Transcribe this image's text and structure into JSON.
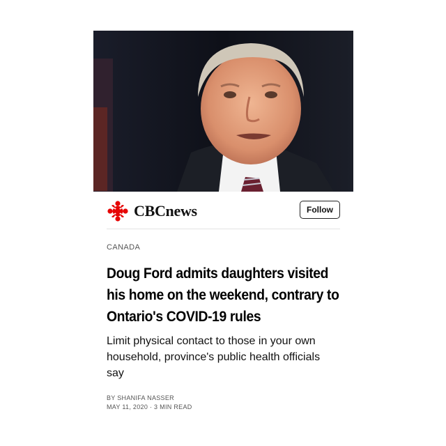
{
  "article": {
    "hero_image": "photo-of-man-speaking-at-podium",
    "publisher": {
      "name": "CBCnews",
      "logo_icon": "cbc-gem-icon",
      "follow_label": "Follow"
    },
    "section": "CANADA",
    "headline": "Doug Ford admits daughters visited his home on the weekend, contrary to Ontario's COVID-19 rules",
    "subheadline": "Limit physical contact to those in your own household, province's public health officials say",
    "byline": "BY SHANIFA NASSER",
    "meta": "MAY 11, 2020 · 3 MIN READ"
  },
  "colors": {
    "brand_red": "#e60505",
    "background": "#ffffff",
    "text": "#111111"
  }
}
